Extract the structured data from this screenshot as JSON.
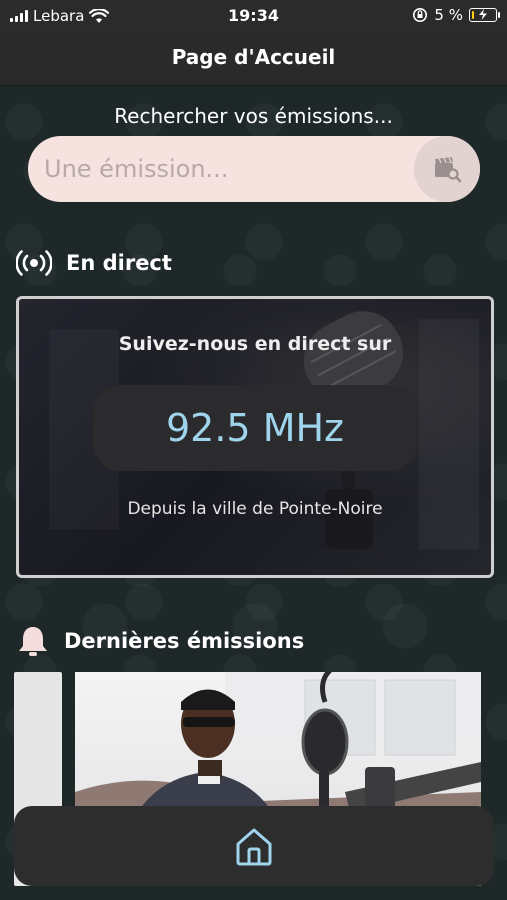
{
  "status_bar": {
    "carrier": "Lebara",
    "time": "19:34",
    "battery_percent": "5 %",
    "battery_level": 0.05
  },
  "header": {
    "title": "Page d'Accueil"
  },
  "search": {
    "prompt": "Rechercher vos émissions...",
    "placeholder": "Une émission...",
    "button_icon": "search-clapperboard-icon"
  },
  "live": {
    "heading": "En direct",
    "heading_icon": "broadcast-icon",
    "title": "Suivez-nous en direct sur",
    "frequency": "92.5 MHz",
    "location": "Depuis la ville de Pointe-Noire"
  },
  "latest": {
    "heading": "Dernières émissions",
    "heading_icon": "bell-icon"
  },
  "nav": {
    "home_icon": "home-icon"
  },
  "colors": {
    "accent": "#9fd4ec",
    "search_bg": "#f6e3e0",
    "background": "#1e2829"
  }
}
